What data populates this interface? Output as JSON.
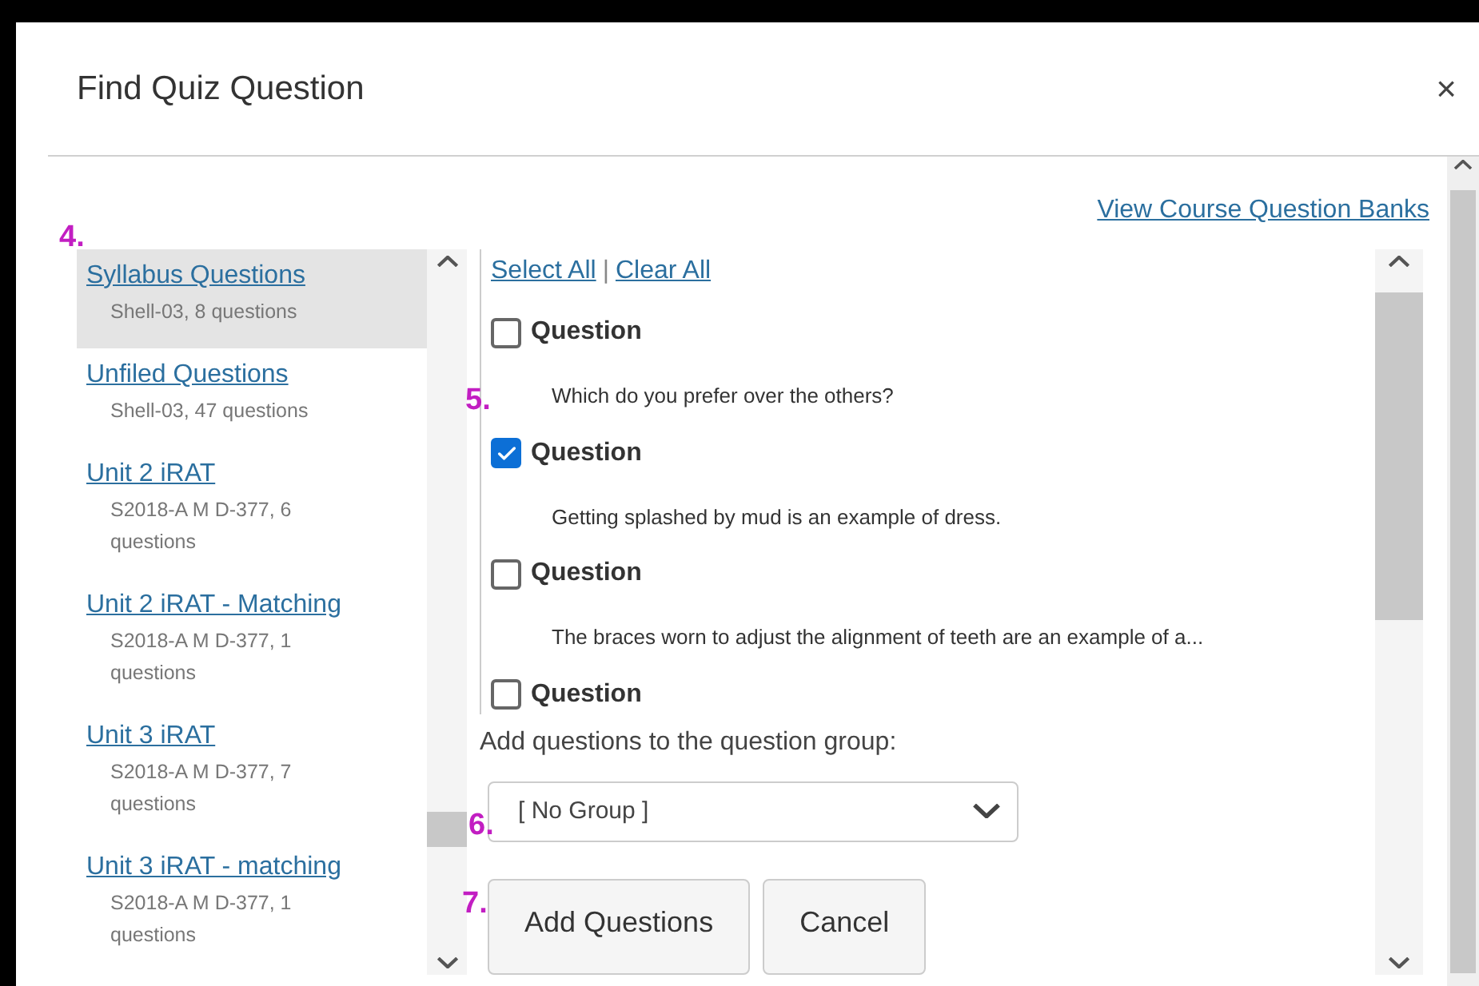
{
  "dialog": {
    "title": "Find Quiz Question",
    "close": "×"
  },
  "view_banks_link": "View Course Question Banks",
  "banks": [
    {
      "name": "Syllabus Questions",
      "info": "Shell-03, 8 questions",
      "selected": true
    },
    {
      "name": "Unfiled Questions",
      "info": "Shell-03, 47 questions",
      "selected": false
    },
    {
      "name": "Unit 2 iRAT",
      "info": "S2018-A M D-377, 6 questions",
      "selected": false
    },
    {
      "name": "Unit 2 iRAT - Matching",
      "info": "S2018-A M D-377, 1 questions",
      "selected": false
    },
    {
      "name": "Unit 3 iRAT",
      "info": "S2018-A M D-377, 7 questions",
      "selected": false
    },
    {
      "name": "Unit 3 iRAT - matching",
      "info": "S2018-A M D-377, 1 questions",
      "selected": false
    }
  ],
  "select_all": "Select All",
  "separator": "|",
  "clear_all": "Clear All",
  "questions": [
    {
      "label": "Question",
      "text": "Which do you prefer over the others?",
      "checked": false
    },
    {
      "label": "Question",
      "text": "Getting splashed by mud is an example of dress.",
      "checked": true
    },
    {
      "label": "Question",
      "text": "The braces worn to adjust the alignment of teeth are an example of a...",
      "checked": false
    },
    {
      "label": "Question",
      "checked": false
    }
  ],
  "group_label": "Add questions to the question group:",
  "group_select": {
    "value": "[ No Group ]"
  },
  "buttons": [
    "Add Questions",
    "Cancel"
  ],
  "annotations": [
    "4.",
    "5.",
    "6.",
    "7."
  ]
}
